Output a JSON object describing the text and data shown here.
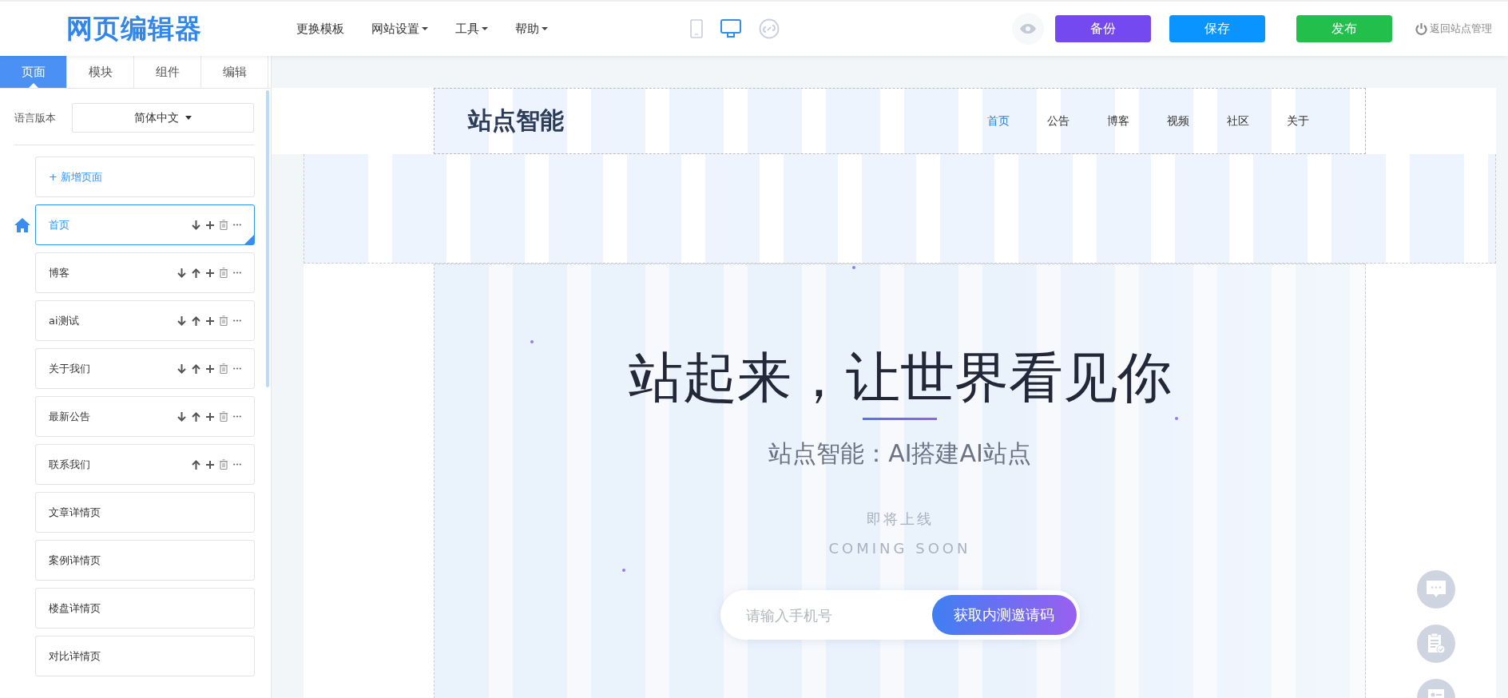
{
  "topbar": {
    "logo": "网页编辑器",
    "menu": [
      {
        "label": "更换模板",
        "dropdown": false
      },
      {
        "label": "网站设置",
        "dropdown": true
      },
      {
        "label": "工具",
        "dropdown": true
      },
      {
        "label": "帮助",
        "dropdown": true
      }
    ],
    "devices": [
      {
        "kind": "phone",
        "selected": false
      },
      {
        "kind": "desktop",
        "selected": true
      },
      {
        "kind": "miniapp",
        "selected": false
      }
    ],
    "buttons": [
      {
        "label": "备份",
        "color": "#7549f0"
      },
      {
        "label": "保存",
        "color": "#0a94ff"
      },
      {
        "label": "发布",
        "color": "#22bf4c"
      }
    ],
    "return_link": "返回站点管理"
  },
  "sidebar": {
    "tabs": [
      {
        "label": "页面",
        "selected": true
      },
      {
        "label": "模块",
        "selected": false
      },
      {
        "label": "组件",
        "selected": false
      },
      {
        "label": "编辑",
        "selected": false
      }
    ],
    "language_label": "语言版本",
    "language_value": "简体中文",
    "add_page": "+ 新增页面",
    "pages": [
      {
        "name": "首页",
        "selected": true,
        "home": true,
        "actions": [
          {
            "kind": "down"
          },
          {
            "kind": "add"
          },
          {
            "kind": "delete"
          },
          {
            "kind": "more"
          }
        ]
      },
      {
        "name": "博客",
        "selected": false,
        "home": false,
        "actions": [
          {
            "kind": "down"
          },
          {
            "kind": "up"
          },
          {
            "kind": "add"
          },
          {
            "kind": "delete"
          },
          {
            "kind": "more"
          }
        ]
      },
      {
        "name": "ai测试",
        "selected": false,
        "home": false,
        "actions": [
          {
            "kind": "down"
          },
          {
            "kind": "up"
          },
          {
            "kind": "add"
          },
          {
            "kind": "delete"
          },
          {
            "kind": "more"
          }
        ]
      },
      {
        "name": "关于我们",
        "selected": false,
        "home": false,
        "actions": [
          {
            "kind": "down"
          },
          {
            "kind": "up"
          },
          {
            "kind": "add"
          },
          {
            "kind": "delete"
          },
          {
            "kind": "more"
          }
        ]
      },
      {
        "name": "最新公告",
        "selected": false,
        "home": false,
        "actions": [
          {
            "kind": "down"
          },
          {
            "kind": "up"
          },
          {
            "kind": "add"
          },
          {
            "kind": "delete"
          },
          {
            "kind": "more"
          }
        ]
      },
      {
        "name": "联系我们",
        "selected": false,
        "home": false,
        "actions": [
          {
            "kind": "up"
          },
          {
            "kind": "add"
          },
          {
            "kind": "delete"
          },
          {
            "kind": "more"
          }
        ]
      },
      {
        "name": "文章详情页",
        "selected": false,
        "home": false
      },
      {
        "name": "案例详情页",
        "selected": false,
        "home": false
      },
      {
        "name": "楼盘详情页",
        "selected": false,
        "home": false
      },
      {
        "name": "对比详情页",
        "selected": false,
        "home": false
      }
    ]
  },
  "preview": {
    "site_logo": "站点智能",
    "nav": [
      {
        "label": "首页",
        "selected": true
      },
      {
        "label": "公告",
        "selected": false
      },
      {
        "label": "博客",
        "selected": false
      },
      {
        "label": "视频",
        "selected": false
      },
      {
        "label": "社区",
        "selected": false
      },
      {
        "label": "关于",
        "selected": false
      }
    ],
    "hero_title": "站起来，让世界看见你",
    "hero_subtitle": "站点智能：AI搭建AI站点",
    "coming_soon_zh": "即将上线",
    "coming_soon_en": "COMING SOON",
    "phone_placeholder": "请输入手机号",
    "invite_button": "获取内测邀请码"
  }
}
